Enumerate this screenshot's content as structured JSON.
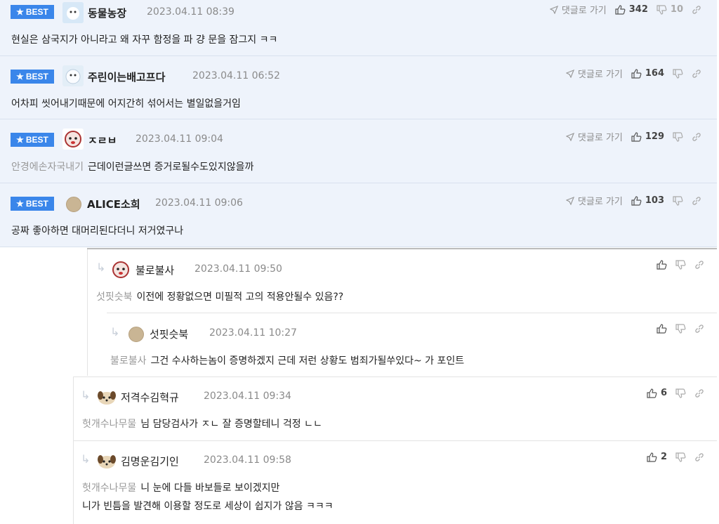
{
  "best_label": "BEST",
  "goto_reply_label": "댓글로 가기",
  "comments": [
    {
      "nickname": "동물농장",
      "date": "2023.04.11 08:39",
      "likes": "342",
      "dislikes": "10",
      "mention": "",
      "text": "현실은 삼국지가 아니라고 왜 자꾸 함정을 파 걍 문을 잠그지 ㅋㅋ"
    },
    {
      "nickname": "주린이는배고프다",
      "date": "2023.04.11 06:52",
      "likes": "164",
      "dislikes": "",
      "mention": "",
      "text": "어차피 씻어내기때문에 어지간히 섞어서는 별일없을거임"
    },
    {
      "nickname": "ㅈㄹㅂ",
      "date": "2023.04.11 09:04",
      "likes": "129",
      "dislikes": "",
      "mention": "안경에손자국내기",
      "text": "근데이런글쓰면 증거로될수도있지않을까"
    },
    {
      "nickname": "ALICE소희",
      "date": "2023.04.11 09:06",
      "likes": "103",
      "dislikes": "",
      "mention": "",
      "text": "공짜 좋아하면 대머리된다더니 저거였구나"
    }
  ],
  "replies": [
    {
      "nickname": "불로불사",
      "date": "2023.04.11 09:50",
      "likes": "",
      "mention": "섯핏슷북",
      "text": "이전에 정황없으면 미필적 고의 적용안될수 있음??"
    },
    {
      "nickname": "섯핏슷북",
      "date": "2023.04.11 10:27",
      "likes": "",
      "mention": "불로불사",
      "text": "그건 수사하는놈이 증명하겠지 근데 저런 상황도 범죄가될쑤있다~ 가 포인트"
    },
    {
      "nickname": "저격수김혁규",
      "date": "2023.04.11 09:34",
      "likes": "6",
      "mention": "헛개수나무물",
      "text": "님 담당검사가 ㅈㄴ 잘 증명할테니 걱정 ㄴㄴ"
    },
    {
      "nickname": "김명운김기인",
      "date": "2023.04.11 09:58",
      "likes": "2",
      "mention": "헛개수나무물",
      "text": "니 눈에 다들 바보들로 보이겠지만",
      "text2": "니가 빈틈을 발견해 이용할 정도로 세상이 쉽지가 않음 ㅋㅋㅋ"
    }
  ],
  "colors": {
    "best_bg": "#eef3fb",
    "badge": "#3a86ea",
    "muted": "#8a8a8a"
  }
}
